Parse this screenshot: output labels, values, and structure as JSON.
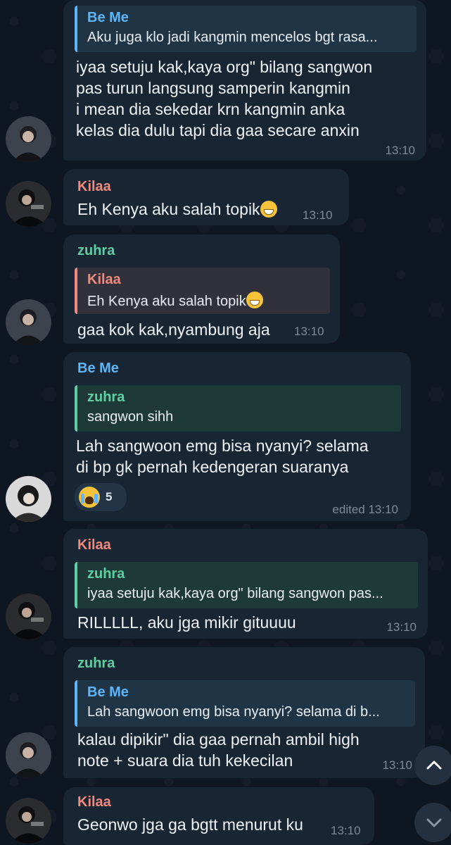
{
  "messages": [
    {
      "id": "m1",
      "quote": {
        "name": "Be Me",
        "text": "Aku juga klo jadi kangmin mencelos bgt rasa..."
      },
      "lines": [
        "iyaa setuju kak,kaya org\" bilang sangwon",
        "pas turun langsung samperin kangmin",
        "i mean dia sekedar krn kangmin anka",
        "kelas dia dulu tapi dia gaa secare anxin"
      ],
      "time": "13:10"
    },
    {
      "id": "m2",
      "sender": "Kilaa",
      "lines": [
        "Eh Kenya aku salah topik"
      ],
      "time": "13:10"
    },
    {
      "id": "m3",
      "sender": "zuhra",
      "quote": {
        "name": "Kilaa",
        "text": "Eh Kenya aku salah topik"
      },
      "lines": [
        "gaa kok kak,nyambung aja"
      ],
      "time": "13:10"
    },
    {
      "id": "m4",
      "sender": "Be Me",
      "quote": {
        "name": "zuhra",
        "text": "sangwon sihh"
      },
      "lines": [
        "Lah sangwoon emg bisa nyanyi? selama",
        "di bp gk pernah kedengeran suaranya"
      ],
      "reaction": {
        "icon": "crying-face",
        "count": "5"
      },
      "time": "edited 13:10"
    },
    {
      "id": "m5",
      "sender": "Kilaa",
      "quote": {
        "name": "zuhra",
        "text": "iyaa setuju kak,kaya org\" bilang sangwon pas..."
      },
      "lines": [
        "RILLLLL, aku jga mikir gituuuu"
      ],
      "time": "13:10"
    },
    {
      "id": "m6",
      "sender": "zuhra",
      "quote": {
        "name": "Be Me",
        "text": "Lah sangwoon emg bisa nyanyi? selama di b..."
      },
      "lines": [
        "kalau dipikir\" dia gaa pernah ambil high",
        "note + suara dia tuh kekecilan"
      ],
      "time": "13:10"
    },
    {
      "id": "m7",
      "sender": "Kilaa",
      "lines": [
        "Geonwo jga ga bgtt menurut ku"
      ],
      "time": "13:10"
    }
  ],
  "colors": {
    "be_me": "#5eb5f7",
    "kilaa": "#f08a7e",
    "zuhra": "#5fcfa3",
    "bubble": "#182533",
    "background": "#0e1621"
  },
  "icons": {
    "scroll_up": "chevron-up-icon",
    "scroll_down": "chevron-down-icon"
  }
}
